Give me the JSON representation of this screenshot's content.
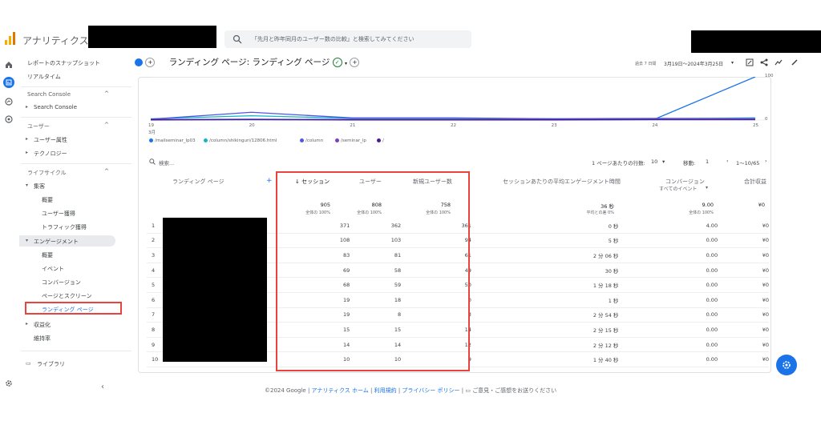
{
  "app": {
    "title": "アナリティクス"
  },
  "search": {
    "placeholder": "「先月と昨年同月のユーザー数の比較」と検索してみてください"
  },
  "header": {
    "page_title": "ランディング ページ: ランディング ページ",
    "date_prefix": "過去 7 日間",
    "date_range": "3月19日～2024年3月25日"
  },
  "sidebar": {
    "top_items": [
      "レポートのスナップショット",
      "リアルタイム"
    ],
    "sections": [
      {
        "title": "Search Console",
        "items": [
          "Search Console"
        ]
      },
      {
        "title": "ユーザー",
        "items": [
          "ユーザー属性",
          "テクノロジー"
        ]
      },
      {
        "title": "ライフサイクル",
        "items": [
          "集客",
          "概要",
          "ユーザー獲得",
          "トラフィック獲得",
          "エンゲージメント",
          "概要",
          "イベント",
          "コンバージョン",
          "ページとスクリーン",
          "ランディング ページ",
          "収益化",
          "維持率"
        ]
      }
    ],
    "library": "ライブラリ"
  },
  "chart_data": {
    "type": "line",
    "x": [
      "19",
      "20",
      "21",
      "22",
      "23",
      "24",
      "25"
    ],
    "x_sublabel": "3月",
    "ylim": [
      0,
      100
    ],
    "yticks": [
      "100",
      "0"
    ],
    "series": [
      {
        "name": "/mailseminar_lp03",
        "color": "#1a73e8",
        "values": [
          1,
          2,
          1,
          1,
          1,
          2,
          100
        ]
      },
      {
        "name": "/column/shikinguri/12806.html",
        "color": "#12b5cb",
        "values": [
          3,
          10,
          4,
          4,
          3,
          3,
          5
        ]
      },
      {
        "name": "/column",
        "color": "#4f57e6",
        "values": [
          2,
          18,
          5,
          5,
          3,
          4,
          4
        ]
      },
      {
        "name": "/seminar_lp",
        "color": "#7b3fbf",
        "values": [
          0,
          1,
          0,
          0,
          0,
          1,
          1
        ]
      },
      {
        "name": "/",
        "color": "#4a1d8e",
        "values": [
          1,
          1,
          1,
          1,
          1,
          1,
          1
        ]
      }
    ]
  },
  "table": {
    "search_placeholder": "検索...",
    "rows_per_page_label": "1 ページあたりの行数:",
    "rows_per_page": "10",
    "goto_label": "移動:",
    "goto_value": "1",
    "page_range": "1～10/65",
    "columns": {
      "landing": "ランディング ページ",
      "sessions": "↓ セッション",
      "users": "ユーザー",
      "new_users": "新規ユーザー数",
      "avg_engagement": "セッションあたりの平均エンゲージメント時間",
      "conversions": "コンバージョン",
      "conversions_sub": "すべてのイベント",
      "revenue": "合計収益"
    },
    "totals": {
      "sessions": "905",
      "sessions_sub": "全体の 100%",
      "users": "808",
      "users_sub": "全体の 100%",
      "new_users": "758",
      "new_users_sub": "全体の 100%",
      "avg_engagement": "36 秒",
      "avg_engagement_sub": "平均との差 0%",
      "conversions": "9.00",
      "conversions_sub": "全体の 100%",
      "revenue": "¥0"
    },
    "rows": [
      {
        "n": "1",
        "s": "371",
        "u": "362",
        "nu": "361",
        "t": "0 秒",
        "c": "4.00",
        "r": "¥0"
      },
      {
        "n": "2",
        "s": "108",
        "u": "103",
        "nu": "94",
        "t": "5 秒",
        "c": "0.00",
        "r": "¥0"
      },
      {
        "n": "3",
        "s": "83",
        "u": "81",
        "nu": "61",
        "t": "2 分 06 秒",
        "c": "0.00",
        "r": "¥0"
      },
      {
        "n": "4",
        "s": "69",
        "u": "58",
        "nu": "49",
        "t": "30 秒",
        "c": "0.00",
        "r": "¥0"
      },
      {
        "n": "5",
        "s": "68",
        "u": "59",
        "nu": "50",
        "t": "1 分 18 秒",
        "c": "0.00",
        "r": "¥0"
      },
      {
        "n": "6",
        "s": "19",
        "u": "18",
        "nu": "0",
        "t": "1 秒",
        "c": "0.00",
        "r": "¥0"
      },
      {
        "n": "7",
        "s": "19",
        "u": "8",
        "nu": "3",
        "t": "2 分 54 秒",
        "c": "0.00",
        "r": "¥0"
      },
      {
        "n": "8",
        "s": "15",
        "u": "15",
        "nu": "14",
        "t": "2 分 15 秒",
        "c": "0.00",
        "r": "¥0"
      },
      {
        "n": "9",
        "s": "14",
        "u": "14",
        "nu": "12",
        "t": "2 分 12 秒",
        "c": "0.00",
        "r": "¥0"
      },
      {
        "n": "10",
        "s": "10",
        "u": "10",
        "nu": "9",
        "t": "1 分 40 秒",
        "c": "0.00",
        "r": "¥0"
      }
    ]
  },
  "footer": {
    "copyright": "©2024 Google |",
    "links": [
      "アナリティクス ホーム",
      "利用規約",
      "プライバシー ポリシー"
    ],
    "feedback": "ご意見・ご感想をお送りください"
  }
}
